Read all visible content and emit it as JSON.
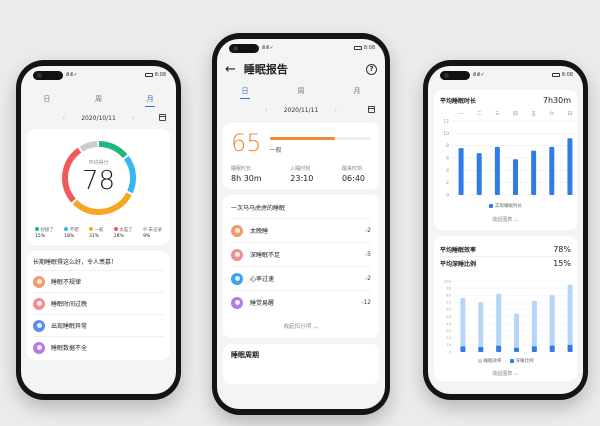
{
  "status": {
    "signal": "ıll ıll ✓",
    "time": "8:08"
  },
  "left": {
    "tabs": [
      {
        "label": "日"
      },
      {
        "label": "周"
      },
      {
        "label": "月"
      }
    ],
    "date": "2020/10/11",
    "ring_label": "平均得分",
    "score": "78",
    "legend": [
      {
        "name": "好极了",
        "pct": "15%",
        "color": "#1fb87a"
      },
      {
        "name": "不错",
        "pct": "18%",
        "color": "#37b7f0"
      },
      {
        "name": "一般",
        "pct": "31%",
        "color": "#f5a623"
      },
      {
        "name": "太差了",
        "pct": "28%",
        "color": "#f05a5a"
      },
      {
        "name": "未记录",
        "pct": "9%",
        "color": "#cccccc"
      }
    ],
    "summary": "长期睡眠得这么好，令人羡慕！",
    "items": [
      {
        "label": "睡眠不规律",
        "color": "#f59a6a"
      },
      {
        "label": "睡眠时间过晚",
        "color": "#f28e8e"
      },
      {
        "label": "出现睡眠异常",
        "color": "#5b8def"
      },
      {
        "label": "睡眠数据不全",
        "color": "#b37be8"
      }
    ]
  },
  "mid": {
    "title": "睡眠报告",
    "tabs": [
      {
        "label": "日"
      },
      {
        "label": "周"
      },
      {
        "label": "月"
      }
    ],
    "date": "2020/11/11",
    "score": "65",
    "score_desc": "一般",
    "score_bar_fraction": 0.65,
    "stats": [
      {
        "label": "睡眠时长",
        "value": "8h 30m"
      },
      {
        "label": "入睡时刻",
        "value": "23:10"
      },
      {
        "label": "醒来时刻",
        "value": "06:40"
      }
    ],
    "section": "一次马马虎虎的睡眠",
    "items": [
      {
        "label": "太晚睡",
        "delta": "-2",
        "color": "#f59a6a"
      },
      {
        "label": "深睡眠不足",
        "delta": "-5",
        "color": "#f28e8e"
      },
      {
        "label": "心率过速",
        "delta": "-2",
        "color": "#37a3f0"
      },
      {
        "label": "睡觉易醒",
        "delta": "-12",
        "color": "#b37be8"
      }
    ],
    "collapse": "收起扣分项 ︿",
    "bottom_title": "睡眠周期"
  },
  "right": {
    "avg_label": "平均睡眠时长",
    "avg_value": "7h30m",
    "y_ticks": [
      "12",
      "10",
      "8",
      "6",
      "4",
      "2",
      "0"
    ],
    "days": [
      "一",
      "二",
      "三",
      "四",
      "五",
      "六",
      "日"
    ],
    "chart1": {
      "type": "bar",
      "categories": [
        "一",
        "二",
        "三",
        "四",
        "五",
        "六",
        "日"
      ],
      "values": [
        7.6,
        6.8,
        7.8,
        5.8,
        7.2,
        7.8,
        9.2
      ],
      "ylim": [
        0,
        12
      ]
    },
    "legend1": "实际睡眠时长",
    "collapse1": "收起图表 ︿",
    "eff_label": "平均睡眠效率",
    "eff_value": "78%",
    "deep_label": "平均深睡比例",
    "deep_value": "15%",
    "y_ticks2": [
      "100",
      "90",
      "80",
      "70",
      "60",
      "50",
      "40",
      "30",
      "20",
      "10",
      "0"
    ],
    "chart2": {
      "type": "bar",
      "categories": [
        "一",
        "二",
        "三",
        "四",
        "五",
        "六",
        "日"
      ],
      "series": [
        {
          "name": "睡眠效率",
          "values": [
            76,
            70,
            82,
            54,
            72,
            80,
            95
          ]
        },
        {
          "name": "深睡比例",
          "values": [
            8,
            7,
            9,
            6,
            8,
            9,
            10
          ]
        }
      ],
      "ylim": [
        0,
        100
      ]
    },
    "legend2": [
      {
        "name": "睡眠效率"
      },
      {
        "name": "深睡比例"
      }
    ],
    "collapse2": "收起图表 ︿"
  }
}
